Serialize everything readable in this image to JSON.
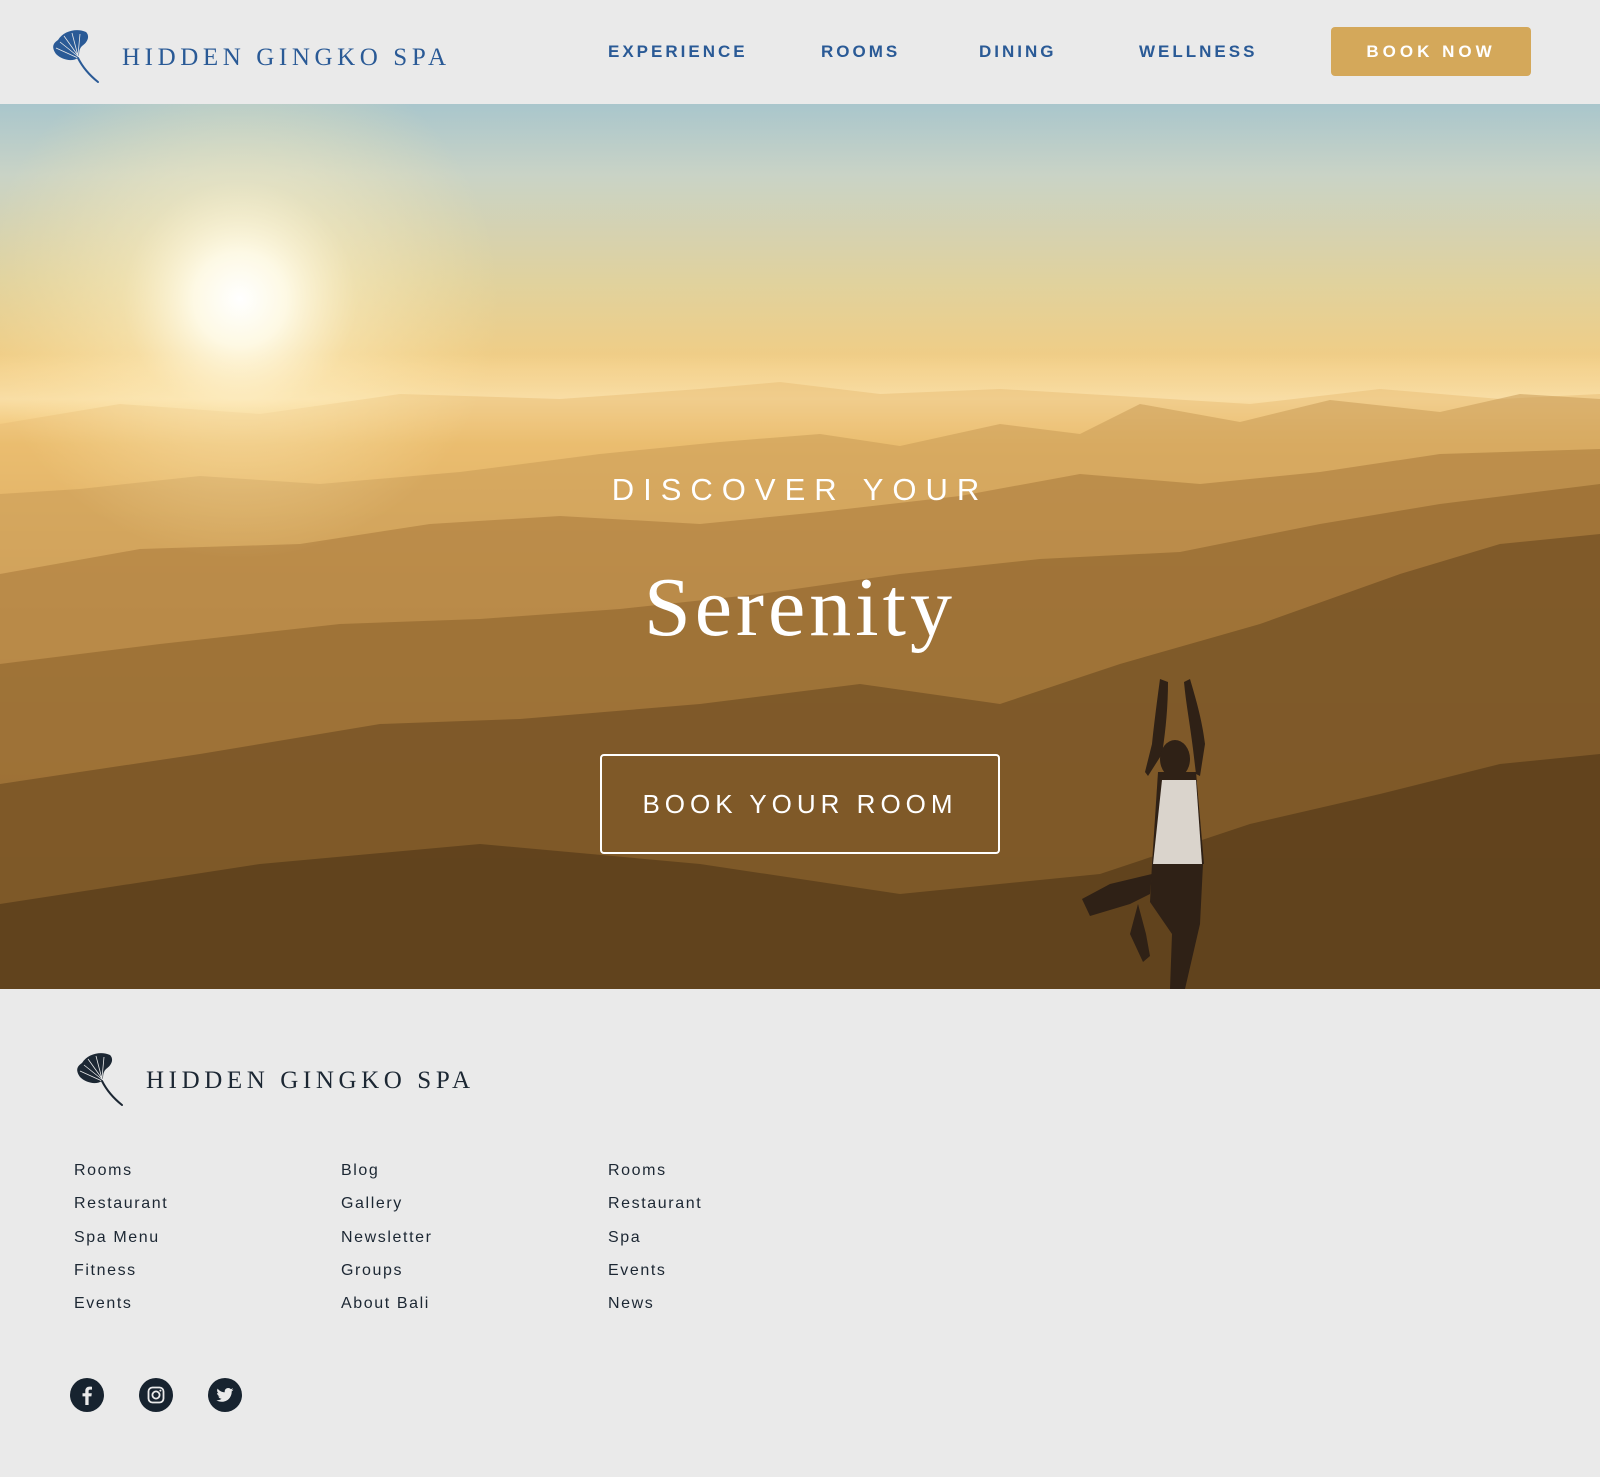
{
  "brand": {
    "name": "HIDDEN GINGKO SPA",
    "logo_icon": "ginkgo-leaf-icon",
    "colors": {
      "primary": "#2a5a96",
      "accent": "#d4a85a",
      "dark": "#1c2733",
      "background": "#eaeaea"
    }
  },
  "header": {
    "nav": [
      "EXPERIENCE",
      "ROOMS",
      "DINING",
      "WELLNESS"
    ],
    "cta_label": "BOOK NOW"
  },
  "hero": {
    "kicker": "DISCOVER YOUR",
    "title": "Serenity",
    "cta_label": "BOOK YOUR ROOM"
  },
  "footer": {
    "brand_name": "HIDDEN GINGKO SPA",
    "columns": [
      [
        "Rooms",
        "Restaurant",
        "Spa Menu",
        "Fitness",
        "Events"
      ],
      [
        "Blog",
        "Gallery",
        "Newsletter",
        "Groups",
        "About Bali"
      ],
      [
        "Rooms",
        "Restaurant",
        "Spa",
        "Events",
        "News"
      ]
    ],
    "social": [
      "facebook-icon",
      "instagram-icon",
      "twitter-icon"
    ]
  }
}
